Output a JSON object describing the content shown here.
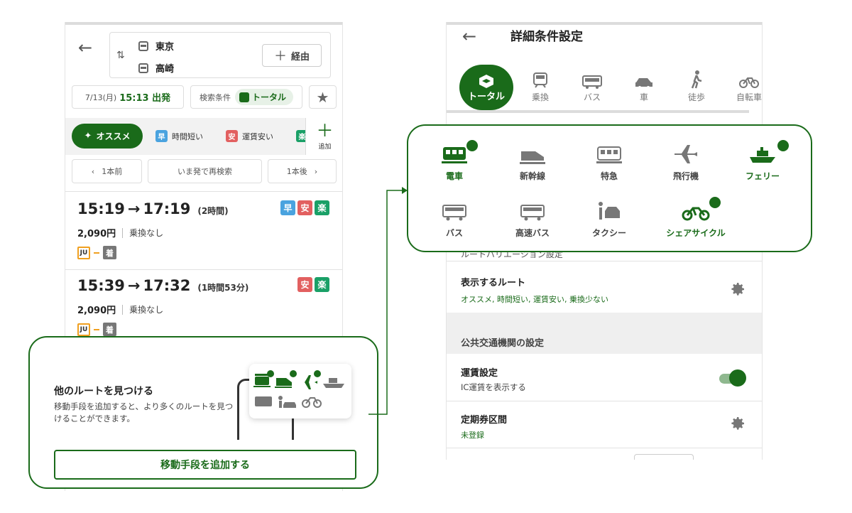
{
  "colors": {
    "accent": "#1a6b1a",
    "fast": "#4aa3df",
    "cheap": "#e26060",
    "easy": "#1aa067",
    "ju": "#f0a020"
  },
  "left": {
    "from": "東京",
    "to": "高崎",
    "via_label": "経由",
    "depart_date": "7/13(月)",
    "depart_time": "15:13 出発",
    "search_cond_label": "検索条件",
    "search_cond_value": "トータル",
    "filters": {
      "recommended": "オススメ",
      "fast_tag": "早",
      "fast": "時間短い",
      "cheap_tag": "安",
      "cheap": "運賃安い",
      "easy_tag": "楽",
      "add": "追加"
    },
    "pager": {
      "prev": "1本前",
      "now": "いま発で再検索",
      "next": "1本後"
    },
    "routes": [
      {
        "depart": "15:19",
        "arrow": "→",
        "arrive": "17:19",
        "duration": "(2時間)",
        "tags": [
          "早",
          "安",
          "楽"
        ],
        "fare": "2,090円",
        "transfers": "乗換なし",
        "line_badge": "JU",
        "arrive_badge": "着"
      },
      {
        "depart": "15:39",
        "arrow": "→",
        "arrive": "17:32",
        "duration": "(1時間53分)",
        "tags": [
          "安",
          "楽"
        ],
        "fare": "2,090円",
        "transfers": "乗換なし",
        "line_badge": "JU",
        "arrive_badge": "着"
      }
    ],
    "sheet": {
      "title": "他のルートを見つける",
      "desc": "移動手段を追加すると、より多くのルートを見つけることができます。",
      "button": "移動手段を追加する"
    }
  },
  "right": {
    "title": "詳細条件設定",
    "tabs": [
      "トータル",
      "乗換",
      "バス",
      "車",
      "徒歩",
      "自転車"
    ],
    "transport": [
      {
        "label": "電車",
        "icon": "train-icon",
        "on": true
      },
      {
        "label": "新幹線",
        "icon": "shinkansen-icon",
        "on": false
      },
      {
        "label": "特急",
        "icon": "express-train-icon",
        "on": false
      },
      {
        "label": "飛行機",
        "icon": "airplane-icon",
        "on": false
      },
      {
        "label": "フェリー",
        "icon": "ferry-icon",
        "on": true
      },
      {
        "label": "バス",
        "icon": "bus-icon",
        "on": false
      },
      {
        "label": "高速バス",
        "icon": "highway-bus-icon",
        "on": false
      },
      {
        "label": "タクシー",
        "icon": "taxi-icon",
        "on": false
      },
      {
        "label": "シェアサイクル",
        "icon": "share-cycle-icon",
        "on": true
      }
    ],
    "partial_section": "ルートバリエーション設定",
    "display_routes": {
      "label": "表示するルート",
      "value": "オススメ, 時間短い, 運賃安い, 乗換少ない"
    },
    "public_transport_title": "公共交通機関の設定",
    "fare_setting": {
      "label": "運賃設定",
      "sub": "IC運賃を表示する",
      "toggle_on": true
    },
    "commuter": {
      "label": "定期券区間",
      "value": "未登録"
    }
  }
}
